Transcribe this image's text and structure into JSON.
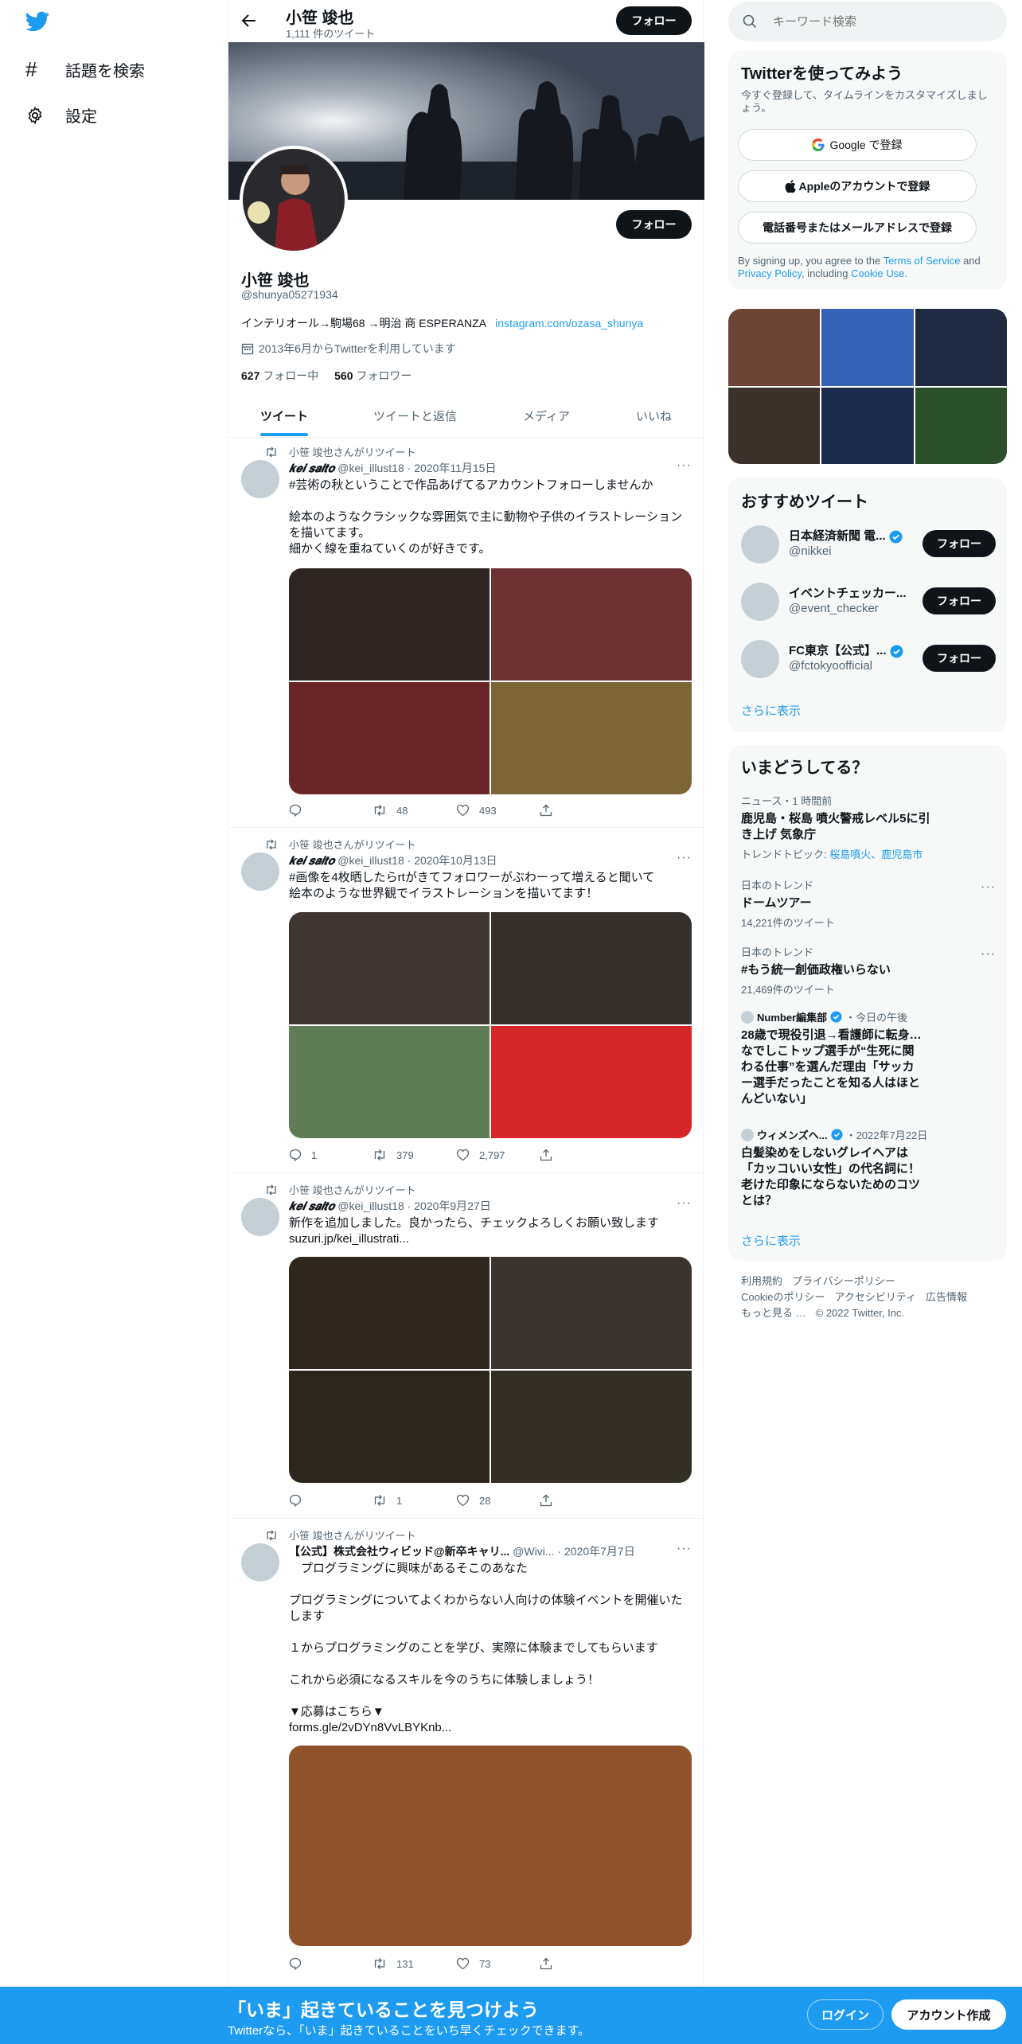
{
  "colors": {
    "accent": "#1d9bf0",
    "dark": "#0f1419",
    "muted": "#536471"
  },
  "nav": {
    "explore": "話題を検索",
    "settings": "設定"
  },
  "header": {
    "name": "小笹 竣也",
    "tweet_count": "1,111 件のツイート",
    "follow": "フォロー"
  },
  "profile": {
    "name": "小笹 竣也",
    "handle": "@shunya05271934",
    "bio": "インテリオール→駒場68 →明治 商 ESPERANZA",
    "bio_link": "instagram.com/ozasa_shunya",
    "joined": "2013年6月からTwitterを利用しています",
    "following_count": "627",
    "following_label": "フォロー中",
    "followers_count": "560",
    "followers_label": "フォロワー",
    "follow": "フォロー"
  },
  "tabs": [
    "ツイート",
    "ツイートと返信",
    "メディア",
    "いいね"
  ],
  "tweets": [
    {
      "retweeted_by": "小笹 竣也さんがリツイート",
      "author": "𝒌𝒆𝒊 𝒔𝒂𝒊𝒕𝒐",
      "handle": "@kei_illust18",
      "date": "2020年11月15日",
      "hashtag": "#芸術の秋ということで作品あげてるアカウントフォローしませんか",
      "lines": [
        "絵本のようなクラシックな雰囲気で主に動物や子供のイラストレーションを描いてます。",
        "細かく線を重ねていくのが好きです。"
      ],
      "images": [
        "#2e2522",
        "#6e3234",
        "#6a2528",
        "#7d6636"
      ],
      "reply": "",
      "retweets": "48",
      "likes": "493"
    },
    {
      "retweeted_by": "小笹 竣也さんがリツイート",
      "author": "𝒌𝒆𝒊 𝒔𝒂𝒊𝒕𝒐",
      "handle": "@kei_illust18",
      "date": "2020年10月13日",
      "hashtag": "#画像を4枚晒したらrtがきてフォロワーがぶわーって増えると聞いて",
      "lines": [
        "絵本のような世界観でイラストレーションを描いてます！"
      ],
      "images": [
        "#403631",
        "#36302c",
        "#607c56",
        "#d7262a"
      ],
      "reply": "1",
      "retweets": "379",
      "likes": "2,797"
    },
    {
      "retweeted_by": "小笹 竣也さんがリツイート",
      "author": "𝒌𝒆𝒊 𝒔𝒂𝒊𝒕𝒐",
      "handle": "@kei_illust18",
      "date": "2020年9月27日",
      "text": "新作を追加しました。良かったら、チェックよろしくお願い致します",
      "link": "suzuri.jp/kei_illustrati...",
      "images": [
        "#2f271e",
        "#3b332d",
        "#2c261d",
        "#332f25"
      ],
      "reply": "",
      "retweets": "1",
      "likes": "28"
    },
    {
      "retweeted_by": "小笹 竣也さんがリツイート",
      "author": "【公式】株式会社ウィビッド@新卒キャリ...",
      "handle": "@Wivi...",
      "date": "2020年7月7日",
      "lines": [
        "　プログラミングに興味があるそこのあなた",
        "",
        "プログラミングについてよくわからない人向けの体験イベントを開催いたします",
        "",
        "１からプログラミングのことを学び、実際に体験までしてもらいます",
        "",
        "これから必須になるスキルを今のうちに体験しましょう！",
        "",
        "▼応募はこちら▼"
      ],
      "link": "forms.gle/2vDYn8VvLBYKnb...",
      "image": "#8f522b",
      "reply": "",
      "retweets": "131",
      "likes": "73"
    }
  ],
  "search": {
    "placeholder": "キーワード検索"
  },
  "signup": {
    "title": "Twitterを使ってみよう",
    "subtitle": "今すぐ登録して、タイムラインをカスタマイズしましょう。",
    "google": "Google で登録",
    "apple": "Appleのアカウントで登録",
    "phone": "電話番号またはメールアドレスで登録",
    "terms_prefix": "By signing up, you agree to the",
    "terms": "Terms of Service",
    "and": "and",
    "privacy": "Privacy Policy",
    "including": ", including",
    "cookie": "Cookie Use."
  },
  "media_grid": [
    "#6d4638",
    "#3562b5",
    "#1f2940",
    "#3d322b",
    "#1c2b4b",
    "#2b4f2a"
  ],
  "recommended": {
    "title": "おすすめツイート",
    "show_more": "さらに表示",
    "follow": "フォロー",
    "accounts": [
      {
        "name": "日本経済新聞 電...",
        "handle": "@nikkei"
      },
      {
        "name": "イベントチェッカー...",
        "handle": "@event_checker"
      },
      {
        "name": "FC東京【公式】...",
        "handle": "@fctokyoofficial"
      }
    ]
  },
  "trends": {
    "title": "いまどうしてる？",
    "show_more": "さらに表示",
    "items": [
      {
        "meta": "ニュース・1 時間前",
        "title": "鹿児島・桜島 噴火警戒レベル5に引き上げ 気象庁",
        "tags_prefix": "トレンドトピック: ",
        "tags": "桜島噴火、鹿児島市"
      },
      {
        "meta": "日本のトレンド",
        "title": "ドームツアー",
        "count": "14,221件のツイート"
      },
      {
        "meta": "日本のトレンド",
        "title": "#もう統一創価政権いらない",
        "count": "21,469件のツイート"
      },
      {
        "source": "Number編集部",
        "time": "・今日の午後",
        "title": "28歳で現役引退→看護師に転身…なでしこトップ選手が“生死に関わる仕事”を選んだ理由「サッカー選手だったことを知る人はほとんどいない」"
      },
      {
        "source": "ウィメンズヘ...",
        "time": "・2022年7月22日",
        "title": "白髪染めをしないグレイヘアは「カッコいい女性」の代名詞に！老けた印象にならないためのコツとは？"
      }
    ]
  },
  "footer": [
    "利用規約",
    "プライバシーポリシー",
    "Cookieのポリシー",
    "アクセシビリティ",
    "広告情報",
    "もっと見る …",
    "© 2022 Twitter, Inc."
  ],
  "bottom": {
    "title": "「いま」起きていることを見つけよう",
    "subtitle": "Twitterなら、「いま」起きていることをいち早くチェックできます。",
    "login": "ログイン",
    "signup": "アカウント作成"
  }
}
